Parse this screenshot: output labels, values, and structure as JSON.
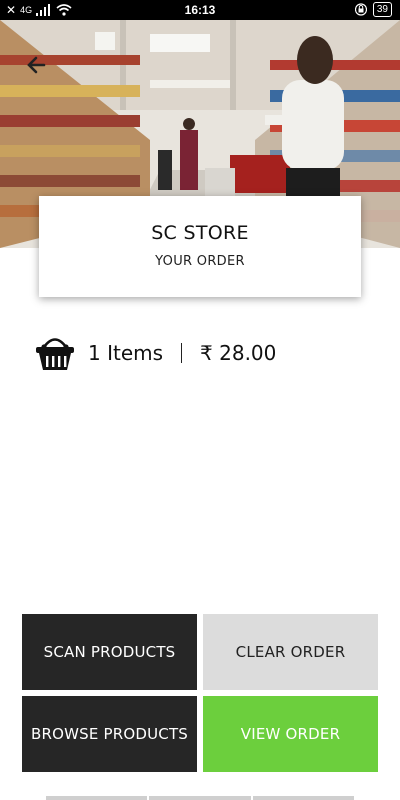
{
  "status_bar": {
    "time": "16:13",
    "network": "4G",
    "battery": "39"
  },
  "store": {
    "name": "SC STORE",
    "subtitle": "YOUR ORDER"
  },
  "summary": {
    "items": "1 Items",
    "total": "₹ 28.00"
  },
  "buttons": {
    "scan": "SCAN PRODUCTS",
    "clear": "CLEAR ORDER",
    "browse": "BROWSE PRODUCTS",
    "view": "VIEW ORDER"
  },
  "colors": {
    "accent_green": "#6ccf3d",
    "dark_button": "#262626",
    "light_button": "#dcdcdc"
  }
}
